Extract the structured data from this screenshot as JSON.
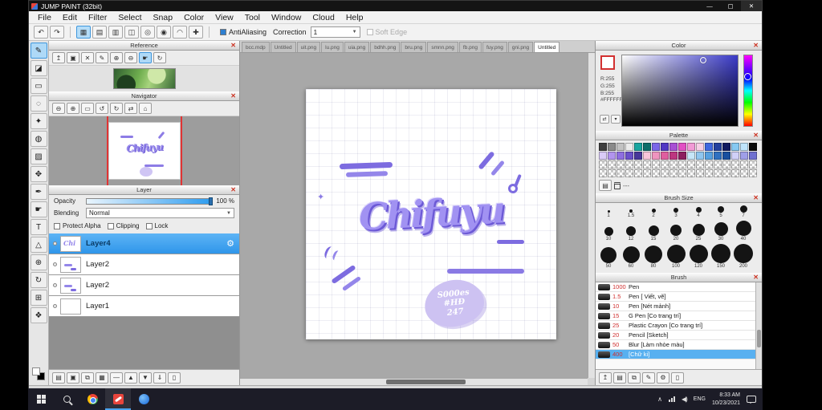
{
  "window": {
    "title": "JUMP PAINT (32bit)",
    "controls": [
      {
        "g": "—",
        "n": "minimize-button"
      },
      {
        "g": "▢",
        "n": "maximize-button"
      },
      {
        "g": "✕",
        "n": "close-button"
      }
    ]
  },
  "menu": {
    "items": [
      "File",
      "Edit",
      "Filter",
      "Select",
      "Snap",
      "Color",
      "View",
      "Tool",
      "Window",
      "Cloud",
      "Help"
    ]
  },
  "toolbar": {
    "history": [
      {
        "g": "↶",
        "n": "undo-button"
      },
      {
        "g": "↷",
        "n": "redo-button"
      }
    ],
    "view_buttons": [
      {
        "g": "▦",
        "n": "snap-off-button",
        "active": true
      },
      {
        "g": "▤",
        "n": "snap-parallel-button"
      },
      {
        "g": "▥",
        "n": "snap-crosshatch-button"
      },
      {
        "g": "◫",
        "n": "snap-vanishing-button"
      },
      {
        "g": "◎",
        "n": "snap-concentric-button"
      },
      {
        "g": "◉",
        "n": "snap-radial-button"
      },
      {
        "g": "◠",
        "n": "snap-curve-button"
      },
      {
        "g": "✚",
        "n": "snap-settings-button"
      }
    ],
    "antialiasing_label": "AntiAliasing",
    "correction_label": "Correction",
    "correction_value": "1",
    "soft_edge_label": "Soft Edge"
  },
  "tabs": [
    {
      "label": "bcc.mdp"
    },
    {
      "label": "Untitled"
    },
    {
      "label": "uit.png"
    },
    {
      "label": "lu.png"
    },
    {
      "label": "uia.png"
    },
    {
      "label": "bdhh.png"
    },
    {
      "label": "bru.png"
    },
    {
      "label": "smnn.png"
    },
    {
      "label": "fb.png"
    },
    {
      "label": "fuy.png"
    },
    {
      "label": "gni.png"
    },
    {
      "label": "Untitled",
      "active": true
    }
  ],
  "tools": [
    {
      "g": "✎",
      "n": "pen-tool",
      "active": true
    },
    {
      "g": "◪",
      "n": "eraser-tool"
    },
    {
      "g": "▭",
      "n": "select-tool"
    },
    {
      "g": "◌",
      "n": "lasso-tool"
    },
    {
      "g": "✦",
      "n": "magic-wand-tool"
    },
    {
      "g": "◍",
      "n": "bucket-tool"
    },
    {
      "g": "▨",
      "n": "gradient-tool"
    },
    {
      "g": "✥",
      "n": "move-tool"
    },
    {
      "g": "✒",
      "n": "eyedropper-tool"
    },
    {
      "g": "☛",
      "n": "hand-tool"
    },
    {
      "g": "T",
      "n": "text-tool"
    },
    {
      "g": "△",
      "n": "shape-tool"
    },
    {
      "g": "⊕",
      "n": "zoom-tool"
    },
    {
      "g": "↻",
      "n": "rotate-tool"
    },
    {
      "g": "⊞",
      "n": "grid-tool"
    },
    {
      "g": "❖",
      "n": "panel-tool"
    }
  ],
  "panels": {
    "reference": {
      "title": "Reference",
      "tools": [
        {
          "g": "↥",
          "n": "import-image-button"
        },
        {
          "g": "▣",
          "n": "open-image-button"
        },
        {
          "g": "✕",
          "n": "clear-reference-button"
        },
        {
          "g": "✎",
          "n": "pick-color-button"
        },
        {
          "g": "⊕",
          "n": "ref-zoom-in-button"
        },
        {
          "g": "⊖",
          "n": "ref-zoom-out-button"
        },
        {
          "g": "☛",
          "n": "ref-pan-button",
          "active": true
        },
        {
          "g": "↻",
          "n": "ref-rotate-button"
        }
      ]
    },
    "navigator": {
      "title": "Navigator",
      "tools": [
        {
          "g": "⊖",
          "n": "nav-zoom-out-button"
        },
        {
          "g": "⊕",
          "n": "nav-zoom-in-button"
        },
        {
          "g": "▭",
          "n": "nav-fit-button"
        },
        {
          "g": "↺",
          "n": "nav-rotate-ccw-button"
        },
        {
          "g": "↻",
          "n": "nav-rotate-cw-button"
        },
        {
          "g": "⇄",
          "n": "nav-flip-button"
        },
        {
          "g": "⌂",
          "n": "nav-reset-button"
        }
      ]
    },
    "layer": {
      "title": "Layer",
      "opacity_label": "Opacity",
      "opacity_value": "100 %",
      "blending_label": "Blending",
      "blending_value": "Normal",
      "checkboxes": [
        "Protect Alpha",
        "Clipping",
        "Lock"
      ],
      "layers": [
        {
          "name": "Layer4",
          "thumb": "text",
          "selected": true
        },
        {
          "name": "Layer2",
          "thumb": "marks"
        },
        {
          "name": "Layer2",
          "thumb": "marks"
        },
        {
          "name": "Layer1",
          "thumb": "empty"
        }
      ],
      "tools": [
        {
          "g": "▤",
          "n": "new-layer-button"
        },
        {
          "g": "▣",
          "n": "new-folder-button"
        },
        {
          "g": "⧉",
          "n": "duplicate-layer-button"
        },
        {
          "g": "▦",
          "n": "rasterize-layer-button"
        },
        {
          "g": "—",
          "n": "divider-icon"
        },
        {
          "g": "▲",
          "n": "move-layer-up-button"
        },
        {
          "g": "▼",
          "n": "move-layer-down-button"
        },
        {
          "g": "⇓",
          "n": "merge-layer-button"
        },
        {
          "g": "▯",
          "n": "delete-layer-button"
        }
      ]
    },
    "color": {
      "title": "Color",
      "r": "R:255",
      "g": "G:255",
      "b": "B:255",
      "hex": "#FFFFFF",
      "tools": [
        {
          "g": "⇄",
          "n": "swap-color-button"
        },
        {
          "g": "▾",
          "n": "color-menu-button"
        }
      ]
    },
    "palette": {
      "title": "Palette",
      "dash": "---",
      "tools": [
        {
          "g": "▤",
          "n": "add-palette-color-button"
        }
      ],
      "swatches": [
        "#3f3f3f",
        "#8a8a8a",
        "#c2c2c2",
        "#ececec",
        "#19a6a0",
        "#0e6e6a",
        "#7a66e8",
        "#5138c4",
        "#a84fd4",
        "#e24fc4",
        "#f29ad6",
        "#f7cfe6",
        "#3f68e0",
        "#22409e",
        "#101a60",
        "#86c9f2",
        "#bfe4fb",
        "#0a0a0a",
        "#dacbf8",
        "#b294ee",
        "#8e6ee0",
        "#6a50ca",
        "#47379a",
        "#f8c6da",
        "#ef94bf",
        "#df5e9f",
        "#bd3680",
        "#8c1f5f",
        "#c6e6f8",
        "#8fc6ef",
        "#56a0e0",
        "#2f70c0",
        "#184f9e",
        "#d0d0f8",
        "#9f9fe8",
        "#6f70d0",
        "checker",
        "checker",
        "checker",
        "checker",
        "checker",
        "checker",
        "checker",
        "checker",
        "checker",
        "checker",
        "checker",
        "checker",
        "checker",
        "checker",
        "checker",
        "checker",
        "checker",
        "checker",
        "checker",
        "checker",
        "checker",
        "checker",
        "checker",
        "checker",
        "checker",
        "checker",
        "checker",
        "checker",
        "checker",
        "checker",
        "checker",
        "checker",
        "checker",
        "checker",
        "checker",
        "checker"
      ]
    },
    "brush_size": {
      "title": "Brush Size",
      "row1": [
        {
          "d": 3,
          "label": "1"
        },
        {
          "d": 4,
          "label": "1.5"
        },
        {
          "d": 5,
          "label": "2"
        },
        {
          "d": 6,
          "label": "3"
        },
        {
          "d": 7,
          "label": "4"
        },
        {
          "d": 8,
          "label": "5"
        },
        {
          "d": 9,
          "label": "7"
        }
      ],
      "row2": [
        {
          "d": 11,
          "label": "10"
        },
        {
          "d": 12,
          "label": "12"
        },
        {
          "d": 13,
          "label": "15"
        },
        {
          "d": 14,
          "label": "20"
        },
        {
          "d": 15,
          "label": "25"
        },
        {
          "d": 17,
          "label": "30"
        },
        {
          "d": 19,
          "label": "40"
        }
      ],
      "row3": [
        {
          "d": 20,
          "label": "50"
        },
        {
          "d": 21,
          "label": "60"
        },
        {
          "d": 22,
          "label": "80"
        },
        {
          "d": 23,
          "label": "100"
        },
        {
          "d": 23,
          "label": "120"
        },
        {
          "d": 24,
          "label": "150"
        },
        {
          "d": 24,
          "label": "200"
        }
      ]
    },
    "brush": {
      "title": "Brush",
      "items": [
        {
          "size": "1000",
          "name": "Pen"
        },
        {
          "size": "1.5",
          "name": "Pen [ Viết, vẽ]"
        },
        {
          "size": "10",
          "name": "Pen [Nét mảnh]"
        },
        {
          "size": "15",
          "name": "G Pen [Co trang trí]"
        },
        {
          "size": "25",
          "name": "Plastic Crayon [Co trang trí]"
        },
        {
          "size": "20",
          "name": "Pencil [Sketch]"
        },
        {
          "size": "50",
          "name": "Blur [Làm nhòe màu]"
        },
        {
          "size": "400",
          "name": "[Chữ ki]",
          "selected": true
        }
      ],
      "tools": [
        {
          "g": "↥",
          "n": "brush-up-button"
        },
        {
          "g": "▤",
          "n": "add-brush-button"
        },
        {
          "g": "⧉",
          "n": "duplicate-brush-button"
        },
        {
          "g": "✎",
          "n": "edit-brush-button"
        },
        {
          "g": "⚙",
          "n": "brush-settings-button"
        },
        {
          "g": "▯",
          "n": "delete-brush-button"
        }
      ]
    }
  },
  "canvas": {
    "title_text": "Chifuyu",
    "bubble": [
      "S000es",
      "#HĐ",
      "247"
    ]
  },
  "taskbar": {
    "lang": "ENG",
    "time": "8:33 AM",
    "date": "10/23/2021"
  }
}
